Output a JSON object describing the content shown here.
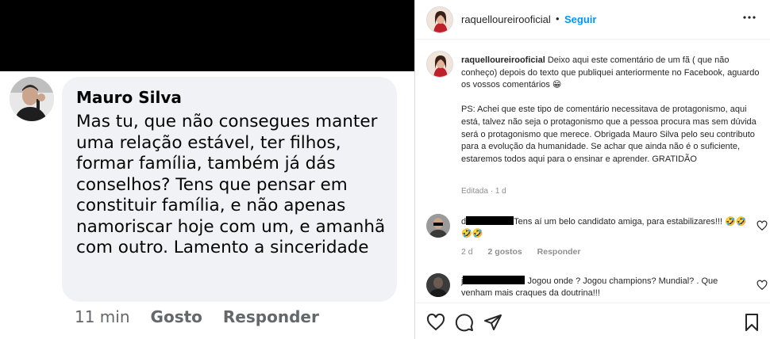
{
  "facebook_comment": {
    "author": "Mauro Silva",
    "text": "Mas tu, que não consegues manter uma relação estável, ter filhos, formar família, também já dás conselhos? Tens que pensar em constituir família, e não apenas namoriscar hoje com um, e amanhã com outro. Lamento a sinceridade",
    "time": "11 min",
    "like_label": "Gosto",
    "reply_label": "Responder"
  },
  "post": {
    "username": "raquelloureirooficial",
    "dot": "•",
    "follow_label": "Seguir",
    "more_icon": "more-horizontal-icon",
    "caption_username": "raquelloureirooficial",
    "caption_part1": "Deixo aqui este comentário de um fã ( que não conheço) depois do texto que publiquei anteriormente no Facebook, aguardo os vossos comentários 😁",
    "caption_part2": "PS: Achei que este tipo de comentário necessitava de protagonismo, aqui está, talvez não seja o protagonismo que a pessoa procura mas sem dúvida será o protagonismo que merece. Obrigada Mauro Silva pelo seu contributo para a evolução da humanidade. Se achar que ainda não é o suficiente, estaremos todos aqui para o ensinar e aprender. GRATIDÃO",
    "edited_label": "Editada",
    "edited_dot": "·",
    "edited_time": "1 d"
  },
  "comments": [
    {
      "username_visible": "d",
      "text": "Tens aí um belo candidato amiga, para estabilizares!!! 🤣🤣🤣🤣",
      "time": "2 d",
      "likes": "2 gostos",
      "reply": "Responder"
    },
    {
      "username_visible": "j",
      "text": "Jogou onde ? Jogou champions? Mundial? . Que venham mais craques da doutrina!!!"
    }
  ],
  "actions": {
    "like_icon": "heart-icon",
    "comment_icon": "comment-icon",
    "share_icon": "share-icon",
    "save_icon": "bookmark-icon"
  },
  "colors": {
    "follow_blue": "#0095f6",
    "text_dark": "#262626",
    "text_muted": "#8e8e8e",
    "fb_bubble": "#f0f2f5"
  }
}
